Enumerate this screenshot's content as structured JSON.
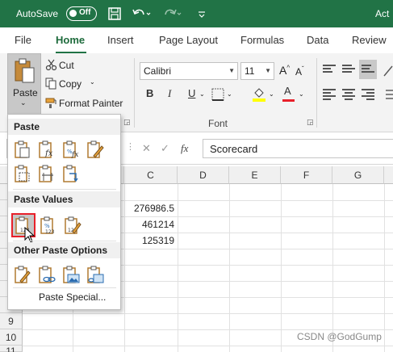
{
  "titlebar": {
    "autosave_label": "AutoSave",
    "autosave_state": "Off",
    "app_title": "Act",
    "bg_color": "#217346"
  },
  "tabs": [
    "File",
    "Home",
    "Insert",
    "Page Layout",
    "Formulas",
    "Data",
    "Review"
  ],
  "active_tab": "Home",
  "clipboard": {
    "paste_label": "Paste",
    "cut_label": "Cut",
    "copy_label": "Copy",
    "format_painter_label": "Format Painter"
  },
  "font": {
    "name": "Calibri",
    "size": "11",
    "group_label": "Font",
    "bold": "B",
    "italic": "I",
    "underline": "U",
    "font_color_letter": "A",
    "font_color": "#e8202a",
    "highlight_color": "#ffff00"
  },
  "formula_bar": {
    "cancel": "✕",
    "enter": "✓",
    "fx": "fx",
    "content": "Scorecard"
  },
  "grid": {
    "columns": [
      "C",
      "D",
      "E",
      "F",
      "G"
    ],
    "rows": [
      "9",
      "10",
      "11"
    ],
    "cells": {
      "c1": "276986.5",
      "c2": "461214",
      "c3": "125319"
    }
  },
  "paste_menu": {
    "section_paste": "Paste",
    "section_values": "Paste Values",
    "section_other": "Other Paste Options",
    "paste_special": "Paste Special...",
    "values_badge": "123"
  },
  "watermark": "CSDN @GodGump"
}
